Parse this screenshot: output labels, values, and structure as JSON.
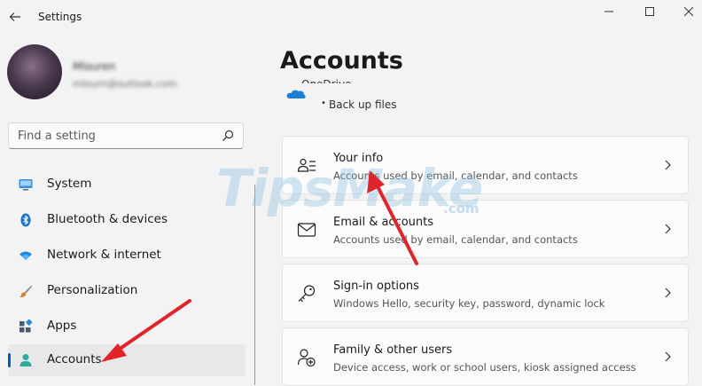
{
  "window": {
    "title": "Settings",
    "back_icon": "arrow-left-icon",
    "controls": [
      "minimize-icon",
      "maximize-icon",
      "close-icon"
    ]
  },
  "user": {
    "name": "Mlouren",
    "email": "mlourn@outlook.com"
  },
  "search": {
    "placeholder": "Find a setting",
    "icon": "search-icon"
  },
  "nav": {
    "items": [
      {
        "label": "System",
        "icon": "system-icon",
        "active": false
      },
      {
        "label": "Bluetooth & devices",
        "icon": "bluetooth-icon",
        "active": false
      },
      {
        "label": "Network & internet",
        "icon": "wifi-icon",
        "active": false
      },
      {
        "label": "Personalization",
        "icon": "brush-icon",
        "active": false
      },
      {
        "label": "Apps",
        "icon": "apps-icon",
        "active": false
      },
      {
        "label": "Accounts",
        "icon": "accounts-icon",
        "active": true
      }
    ]
  },
  "main": {
    "title": "Accounts",
    "onedrive": {
      "label": "OneDrive",
      "bullet": "•",
      "subtitle": "Back up files"
    },
    "cards": [
      {
        "title": "Your info",
        "description": "Accounts used by email, calendar, and contacts",
        "icon": "your-info-icon"
      },
      {
        "title": "Email & accounts",
        "description": "Accounts used by email, calendar, and contacts",
        "icon": "mail-icon"
      },
      {
        "title": "Sign-in options",
        "description": "Windows Hello, security key, password, dynamic lock",
        "icon": "key-icon"
      },
      {
        "title": "Family & other users",
        "description": "Device access, work or school users, kiosk assigned access",
        "icon": "add-user-icon"
      }
    ]
  },
  "watermark": {
    "text": "TipsMake",
    "suffix": ".com"
  },
  "colors": {
    "accent": "#005fb8",
    "background": "#f3f3f3",
    "card": "#fbfbfb",
    "annotation_arrow": "#e0242b"
  }
}
